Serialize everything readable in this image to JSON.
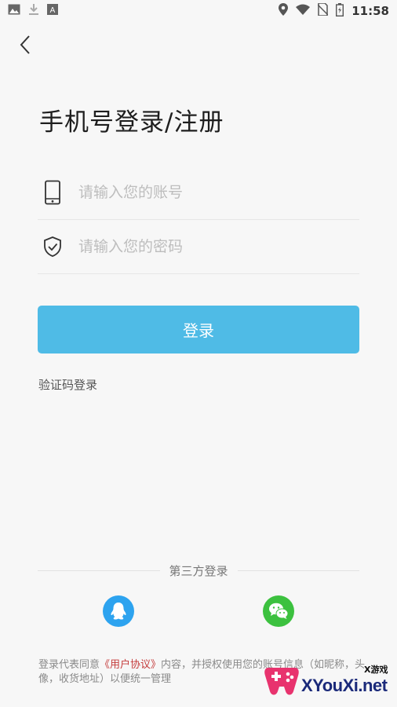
{
  "status_bar": {
    "time": "11:58",
    "left_icons": [
      "image-icon",
      "download-icon",
      "a-icon"
    ],
    "right_icons": [
      "location-icon",
      "wifi-icon",
      "no-sim-icon",
      "battery-icon"
    ]
  },
  "page": {
    "title": "手机号登录/注册"
  },
  "account_field": {
    "placeholder": "请输入您的账号",
    "icon": "phone-icon"
  },
  "password_field": {
    "placeholder": "请输入您的密码",
    "icon": "shield-check-icon"
  },
  "login_button": {
    "label": "登录"
  },
  "sms_login": {
    "label": "验证码登录"
  },
  "third_party": {
    "label": "第三方登录",
    "providers": [
      "qq-icon",
      "wechat-icon"
    ]
  },
  "agreement": {
    "prefix": "登录代表同意",
    "link": "《用户协议》",
    "suffix": "内容，并授权使用您的账号信息（如昵称，头像，收货地址）以便统一管理"
  },
  "watermark": {
    "text": "XYouXi.net",
    "small": "X游戏"
  },
  "colors": {
    "background": "#f7f7f7",
    "primary": "#4fbbe6",
    "qq": "#2da3ef",
    "wechat": "#3cc13f",
    "link": "#c43b3b"
  }
}
